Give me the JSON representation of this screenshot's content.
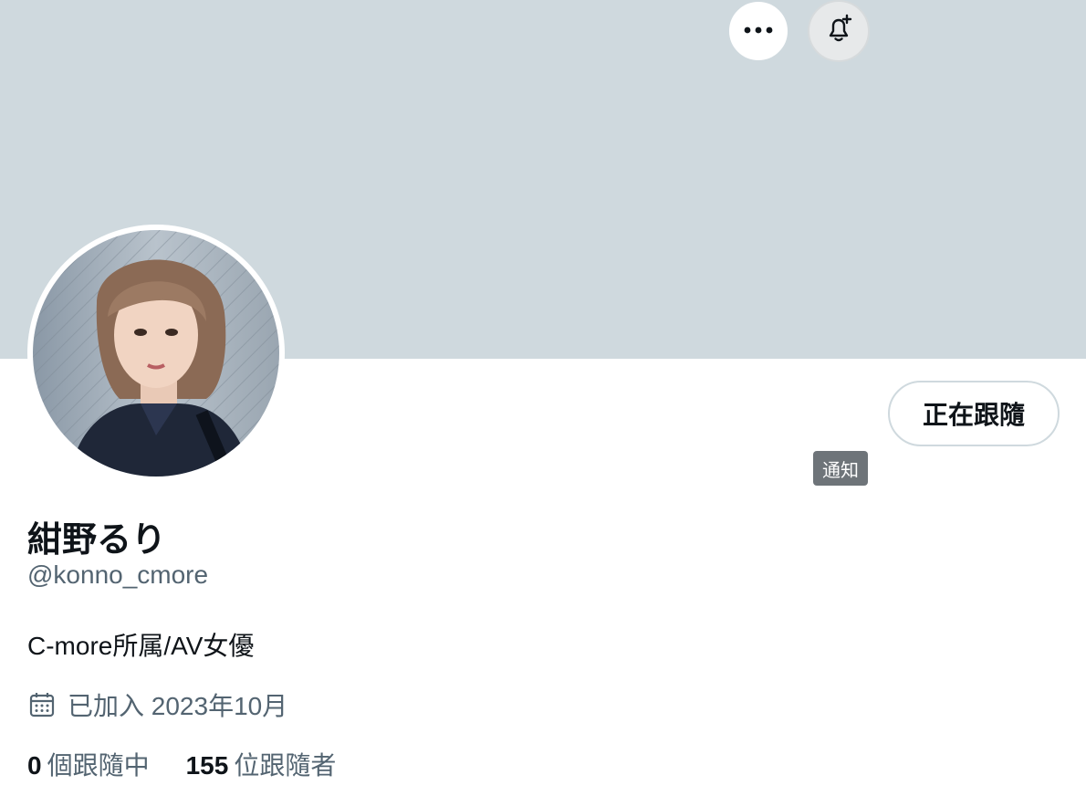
{
  "profile": {
    "name": "紺野るり",
    "handle": "@konno_cmore",
    "bio": "C-more所属/AV女優",
    "joined": "已加入 2023年10月",
    "following_count": "0",
    "following_label": "個跟隨中",
    "followers_count": "155",
    "followers_label": "位跟隨者"
  },
  "actions": {
    "more_icon": "more-horizontal-icon",
    "notify_icon": "bell-plus-icon",
    "notify_tooltip": "通知",
    "follow_label": "正在跟隨"
  },
  "colors": {
    "banner": "#cfd9de",
    "secondary_text": "#536471",
    "primary_text": "#0f1419",
    "tooltip_bg": "#6e7479"
  }
}
